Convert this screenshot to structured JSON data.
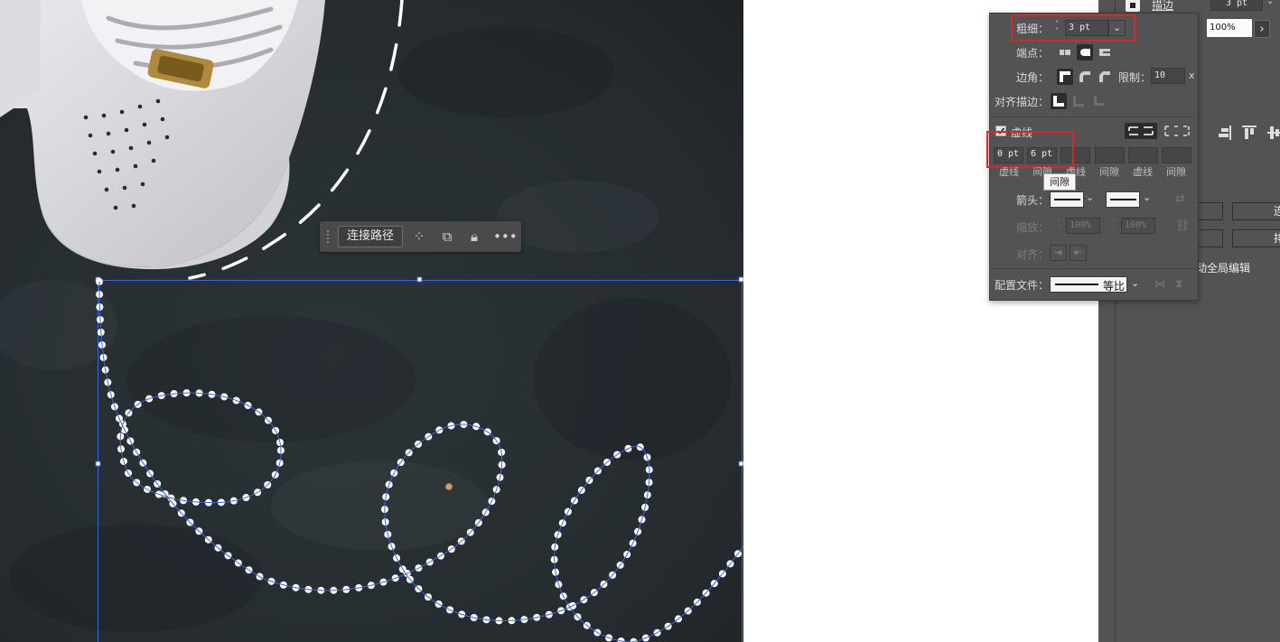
{
  "taskbar": {
    "join_path_label": "连接路径",
    "icons": [
      "anchor-points-icon",
      "duplicate-icon",
      "lock-icon",
      "more-icon"
    ]
  },
  "right_panel": {
    "stroke_title": "描边",
    "weight_value": "3 pt",
    "percent_value": "100%",
    "button1": "连",
    "button2": "排",
    "global_edit": "动全局编辑"
  },
  "stroke_panel": {
    "weight_label": "粗细：",
    "weight_value": "3 pt",
    "cap_label": "端点：",
    "corner_label": "边角：",
    "limit_label": "限制：",
    "limit_value": "10",
    "limit_unit": "x",
    "align_label": "对齐描边：",
    "dashed_label": "虚线",
    "dashed_checked": true,
    "dash_values": [
      "0 pt",
      "6 pt",
      "",
      "",
      "",
      ""
    ],
    "dash_labels": [
      "虚线",
      "间隙",
      "虚线",
      "间隙",
      "虚线",
      "间隙"
    ],
    "tooltip": "间隙",
    "arrow_label": "箭头：",
    "scale_label": "缩放：",
    "scale_values": [
      "100%",
      "100%"
    ],
    "align2_label": "对齐：",
    "profile_label": "配置文件：",
    "profile_value": "等比"
  },
  "colors": {
    "highlight": "#d7262d",
    "selection": "#2f5fe0",
    "panel": "#535353"
  }
}
